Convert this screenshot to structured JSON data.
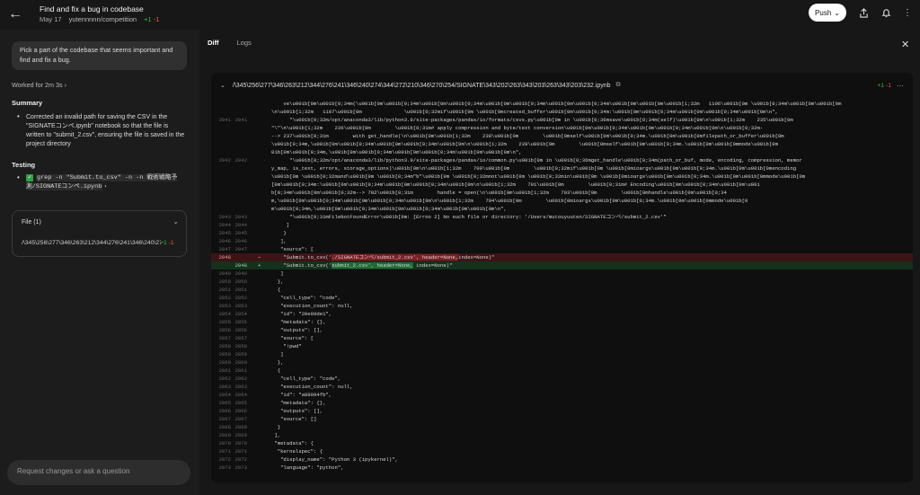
{
  "header": {
    "title": "Find and fix a bug in codebase",
    "date": "May 17",
    "repo": "yutennnnn/competition",
    "additions": "+1",
    "deletions": "-1",
    "push_label": "Push"
  },
  "left_panel": {
    "prompt": "Pick a part of the codebase that seems important and find and fix a bug.",
    "worked_for": "Worked for 2m 3s",
    "summary_heading": "Summary",
    "summary_text": "Corrected an invalid path for saving the CSV in the \"SIGNATEコンペ.ipynb\" notebook so that the file is written to \"submit_2.csv\", ensuring the file is saved in the project directory",
    "testing_heading": "Testing",
    "testing_command": "grep -n \"Submit.to_csv\" -n -n 戦術戦略予測/SIGNATEコンペ.ipynb",
    "file_card_title": "File (1)",
    "file_name": "/\\345\\256\\277\\346\\263\\212\\344\\276\\241\\346\\240\\274\\344\\272\\210\\346\\270\\254/SIGNATE\\343\\202\\263\\343\\203\\263\\343\\203\\232.ipynb",
    "file_additions": "+1",
    "file_deletions": "-1",
    "request_placeholder": "Request changes or ask a question"
  },
  "tabs": {
    "diff": "Diff",
    "logs": "Logs"
  },
  "diff": {
    "file_path": "/\\345\\256\\277\\346\\263\\212\\344\\276\\241\\346\\240\\274\\344\\272\\210\\346\\270\\254/SIGNATE\\343\\202\\263\\343\\203\\263\\343\\203\\232.ipynb",
    "additions": "+1",
    "deletions": "-1",
    "lines": [
      {
        "o": "",
        "n": "",
        "m": "",
        "t": "    ve\\u001b[0m\\u001b[0;34m(\\u001b[0m\\u001b[0;34m\\u001b[0m\\u001b[0;34m\\u001b[0m\\u001b[0;34m\\u001b[0m\\u001b[0;34m\\u001b[0m\\u001b[0m\\u001b[1;32m   1106\\u001b[0m \\u001b[0;34m\\u001b[0m\\u001b[0m"
      },
      {
        "o": "",
        "n": "",
        "m": "",
        "t": "\\n\\u001b[1;32m   1107\\u001b[0m              \\u001b[0;32mif\\u001b[0m \\u001b[0mcreated_buffer\\u001b[0m\\u001b[0;34m:\\u001b[0m\\u001b[0;34m\\u001b[0m\\u001b[0;34m\\u001b[0m\\n\","
      },
      {
        "o": "2041",
        "n": "2041",
        "m": "",
        "t": "      \"\\u001b[0;32m/opt/anaconda3/lib/python3.9/site-packages/pandas/io/formats/csvs.py\\u001b[0m in \\u001b[0;36msave\\u001b[0;34m(self)\\u001b[0m\\n\\u001b[1;32m    235\\u001b[0m"
      },
      {
        "o": "",
        "n": "",
        "m": "",
        "t": "\"\\\"\\n\\u001b[1;32m    236\\u001b[0m        \\u001b[0;31m# apply compression and byte/text conversion\\u001b[0m\\u001b[0;34m\\u001b[0m\\u001b[0;34m\\u001b[0m\\n\\u001b[0;32m-"
      },
      {
        "o": "",
        "n": "",
        "m": "",
        "t": "--> 237\\u001b[0;31m        with get_handle(\\n\\u001b[0m\\u001b[1;32m    238\\u001b[0m        \\u001b[0mself\\u001b[0m\\u001b[0;34m.\\u001b[0m\\u001b[0mfilepath_or_buffer\\u001b[0m"
      },
      {
        "o": "",
        "n": "",
        "m": "",
        "t": "\\u001b[0;34m,\\u001b[0m\\u001b[0;34m\\u001b[0m\\u001b[0;34m\\u001b[0m\\n\\u001b[1;32m    239\\u001b[0m        \\u001b[0mself\\u001b[0m\\u001b[0;34m.\\u001b[0m\\u001b[0mmode\\u001b[0m"
      },
      {
        "o": "",
        "n": "",
        "m": "",
        "t": "01b[0m\\u001b[0;34m,\\u001b[0m\\u001b[0;34m\\u001b[0m\\u001b[0;34m\\u001b[0m\\u001b[0m\\n\","
      },
      {
        "o": "2042",
        "n": "2042",
        "m": "",
        "t": "      \"\\u001b[0;32m/opt/anaconda3/lib/python3.9/site-packages/pandas/io/common.py\\u001b[0m in \\u001b[0;36mget_handle\\u001b[0;34m(path_or_buf, mode, encoding, compression, memor"
      },
      {
        "o": "",
        "n": "",
        "m": "",
        "t": "y_map, is_text, errors, storage_options)\\u001b[0m\\n\\u001b[1;32m    700\\u001b[0m        \\u001b[0;32mif\\u001b[0m \\u001b[0mioargs\\u001b[0m\\u001b[0;34m.\\u001b[0m\\u001b[0mencoding"
      },
      {
        "o": "",
        "n": "",
        "m": "",
        "t": "\\u001b[0m \\u001b[0;32mand\\u001b[0m \\u001b[0;34m\"b\"\\u001b[0m \\u001b[0;32mnot\\u001b[0m \\u001b[0;32min\\u001b[0m \\u001b[0mioargs\\u001b[0m\\u001b[0;34m.\\u001b[0m\\u001b[0mmode\\u001b[0m"
      },
      {
        "o": "",
        "n": "",
        "m": "",
        "t": "[0m\\u001b[0;34m:\\u001b[0m\\u001b[0;34m\\u001b[0m\\u001b[0;34m\\u001b[0m\\n\\u001b[1;32m    701\\u001b[0m        \\u001b[0;31m# Encoding\\u001b[0m\\u001b[0;34m\\u001b[0m\\u001"
      },
      {
        "o": "",
        "n": "",
        "m": "",
        "t": "b[0;34m\\u001b[0m\\u001b[0;32m--> 702\\u001b[0;31m        handle = open(\\n\\u001b[0m\\u001b[1;32m    703\\u001b[0m        \\u001b[0mhandle\\u001b[0m\\u001b[0;34"
      },
      {
        "o": "",
        "n": "",
        "m": "",
        "t": "m,\\u001b[0m\\u001b[0;34m\\u001b[0m\\u001b[0;34m\\u001b[0m\\n\\u001b[1;32m    704\\u001b[0m        \\u001b[0mioargs\\u001b[0m\\u001b[0;34m.\\u001b[0m\\u001b[0mmode\\u001b[0"
      },
      {
        "o": "",
        "n": "",
        "m": "",
        "t": "m\\u001b[0;34m,\\u001b[0m\\u001b[0;34m\\u001b[0m\\u001b[0;34m\\u001b[0m\\u001b[0m\\n\","
      },
      {
        "o": "2043",
        "n": "2043",
        "m": "",
        "t": "      \"\\u001b[0;31mFileNotFoundError\\u001b[0m: [Errno 2] No such file or directory: '/Users/mutouyuuten/SIGNATEコンペ/submit_2.csv'\""
      },
      {
        "o": "2044",
        "n": "2044",
        "m": "",
        "t": "     ]"
      },
      {
        "o": "2045",
        "n": "2045",
        "m": "",
        "t": "    }"
      },
      {
        "o": "2046",
        "n": "2046",
        "m": "",
        "t": "   ],"
      },
      {
        "o": "2047",
        "n": "2047",
        "m": "",
        "t": "   \"source\": ["
      },
      {
        "o": "2048",
        "n": "",
        "m": "−",
        "t": "    \"Submit.to_csv('",
        "hl": "./SIGNATEコンペ/submit_2.csv', header=None,",
        "t2": "index=None)\"",
        "kind": "del"
      },
      {
        "o": "",
        "n": "2048",
        "m": "+",
        "t": "    \"Submit.to_csv('",
        "hl": "submit_2.csv', header=None,",
        "t2": " index=None)\"",
        "kind": "add"
      },
      {
        "o": "2049",
        "n": "2049",
        "m": "",
        "t": "   ]"
      },
      {
        "o": "2050",
        "n": "2050",
        "m": "",
        "t": "  },"
      },
      {
        "o": "2051",
        "n": "2051",
        "m": "",
        "t": "  {"
      },
      {
        "o": "2052",
        "n": "2052",
        "m": "",
        "t": "   \"cell_type\": \"code\","
      },
      {
        "o": "2053",
        "n": "2053",
        "m": "",
        "t": "   \"execution_count\": null,"
      },
      {
        "o": "2054",
        "n": "2054",
        "m": "",
        "t": "   \"id\": \"20e99de1\","
      },
      {
        "o": "2055",
        "n": "2055",
        "m": "",
        "t": "   \"metadata\": {},"
      },
      {
        "o": "2056",
        "n": "2056",
        "m": "",
        "t": "   \"outputs\": [],"
      },
      {
        "o": "2057",
        "n": "2057",
        "m": "",
        "t": "   \"source\": ["
      },
      {
        "o": "2058",
        "n": "2058",
        "m": "",
        "t": "    \"!pwd\""
      },
      {
        "o": "2059",
        "n": "2059",
        "m": "",
        "t": "   ]"
      },
      {
        "o": "2060",
        "n": "2060",
        "m": "",
        "t": "  },"
      },
      {
        "o": "2061",
        "n": "2061",
        "m": "",
        "t": "  {"
      },
      {
        "o": "2062",
        "n": "2062",
        "m": "",
        "t": "   \"cell_type\": \"code\","
      },
      {
        "o": "2063",
        "n": "2063",
        "m": "",
        "t": "   \"execution_count\": null,"
      },
      {
        "o": "2064",
        "n": "2064",
        "m": "",
        "t": "   \"id\": \"a89094fb\","
      },
      {
        "o": "2065",
        "n": "2065",
        "m": "",
        "t": "   \"metadata\": {},"
      },
      {
        "o": "2066",
        "n": "2066",
        "m": "",
        "t": "   \"outputs\": [],"
      },
      {
        "o": "2067",
        "n": "2067",
        "m": "",
        "t": "   \"source\": []"
      },
      {
        "o": "2068",
        "n": "2068",
        "m": "",
        "t": "  }"
      },
      {
        "o": "2069",
        "n": "2069",
        "m": "",
        "t": " ],"
      },
      {
        "o": "2070",
        "n": "2070",
        "m": "",
        "t": " \"metadata\": {"
      },
      {
        "o": "2071",
        "n": "2071",
        "m": "",
        "t": "  \"kernelspec\": {"
      },
      {
        "o": "2072",
        "n": "2072",
        "m": "",
        "t": "   \"display_name\": \"Python 3 (ipykernel)\","
      },
      {
        "o": "2073",
        "n": "2073",
        "m": "",
        "t": "   \"language\": \"python\","
      }
    ]
  }
}
